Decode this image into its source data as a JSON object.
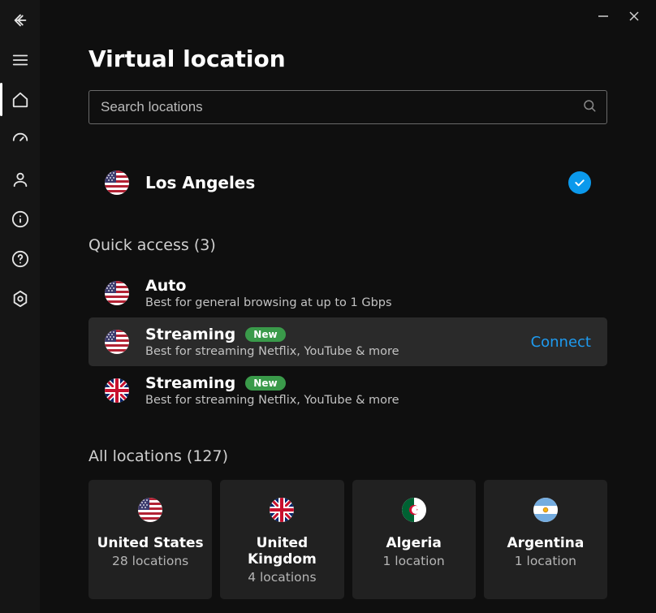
{
  "page_title": "Virtual location",
  "search": {
    "placeholder": "Search locations"
  },
  "current_location": {
    "name": "Los Angeles",
    "flag": "us"
  },
  "quick_access": {
    "title": "Quick access (3)",
    "items": [
      {
        "flag": "us",
        "title": "Auto",
        "subtitle": "Best for general browsing at up to 1 Gbps",
        "badge": "",
        "hovered": false
      },
      {
        "flag": "us",
        "title": "Streaming",
        "subtitle": "Best for streaming Netflix, YouTube & more",
        "badge": "New",
        "hovered": true,
        "connect_label": "Connect"
      },
      {
        "flag": "gb",
        "title": "Streaming",
        "subtitle": "Best for streaming Netflix, YouTube & more",
        "badge": "New",
        "hovered": false
      }
    ]
  },
  "all_locations": {
    "title": "All locations (127)",
    "items": [
      {
        "flag": "us",
        "name": "United States",
        "count": "28 locations"
      },
      {
        "flag": "gb",
        "name": "United Kingdom",
        "count": "4 locations"
      },
      {
        "flag": "dz",
        "name": "Algeria",
        "count": "1 location"
      },
      {
        "flag": "ar",
        "name": "Argentina",
        "count": "1 location"
      }
    ]
  },
  "sidebar": {
    "items": [
      {
        "name": "back",
        "icon": "arrow-left"
      },
      {
        "name": "menu",
        "icon": "menu"
      },
      {
        "name": "home",
        "icon": "home",
        "active": true
      },
      {
        "name": "speed",
        "icon": "gauge"
      },
      {
        "name": "account",
        "icon": "user"
      },
      {
        "name": "info",
        "icon": "info"
      },
      {
        "name": "help",
        "icon": "help"
      },
      {
        "name": "settings",
        "icon": "settings"
      }
    ]
  }
}
